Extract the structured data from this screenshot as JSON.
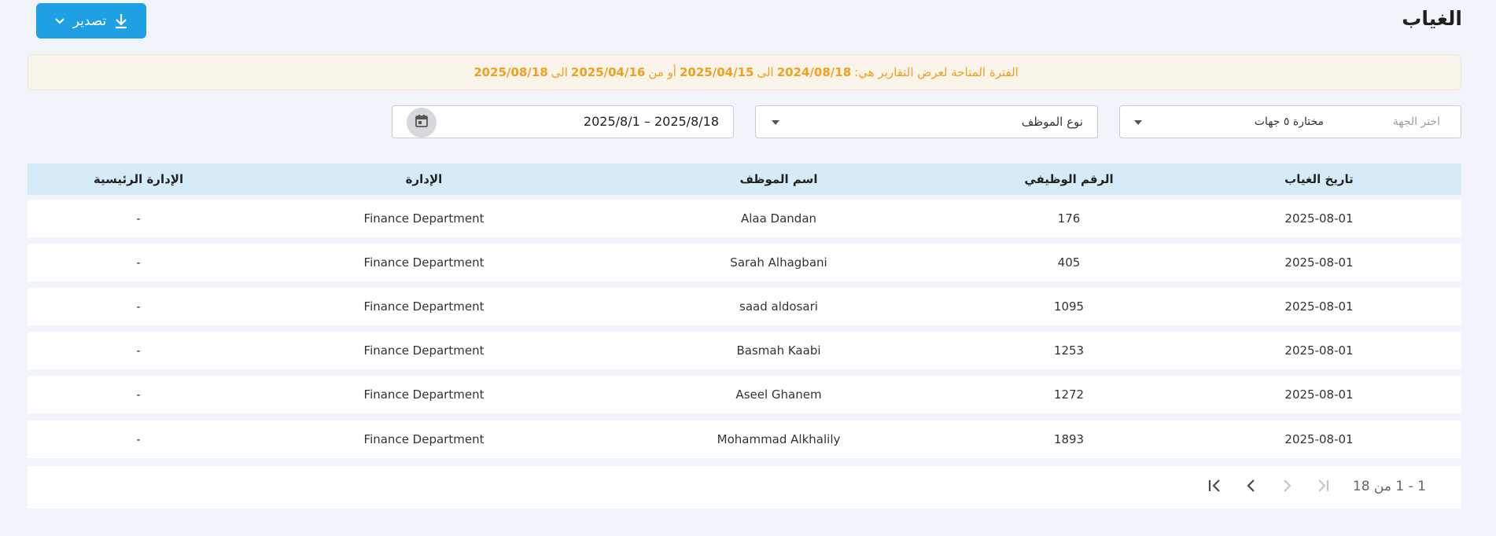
{
  "page": {
    "title": "الغياب"
  },
  "toolbar": {
    "export_label": "تصدير"
  },
  "notice": {
    "prefix": "الفترة المتاحة لعرض التقارير هي:",
    "date1": "2024/08/18",
    "sep1": "الى",
    "date2": "2025/04/15",
    "sep2": "أو من",
    "date3": "2025/04/16",
    "sep3": "الى",
    "date4": "2025/08/18"
  },
  "filters": {
    "department_placeholder": "اختر الجهة",
    "department_value": "مختارة ٥ جهات",
    "employee_type_value": "نوع الموظف",
    "date_range_value": "2025/8/1 – 2025/8/18"
  },
  "table": {
    "headers": [
      "تاريخ الغياب",
      "الرقم الوظيفي",
      "اسم الموظف",
      "الإدارة",
      "الإدارة الرئيسية"
    ],
    "rows": [
      [
        "2025-08-01",
        "176",
        "Alaa Dandan",
        "Finance Department",
        "-"
      ],
      [
        "2025-08-01",
        "405",
        "Sarah Alhagbani",
        "Finance Department",
        "-"
      ],
      [
        "2025-08-01",
        "1095",
        "saad aldosari",
        "Finance Department",
        "-"
      ],
      [
        "2025-08-01",
        "1253",
        "Basmah Kaabi",
        "Finance Department",
        "-"
      ],
      [
        "2025-08-01",
        "1272",
        "Aseel Ghanem",
        "Finance Department",
        "-"
      ],
      [
        "2025-08-01",
        "1893",
        "Mohammad Alkhalily",
        "Finance Department",
        "-"
      ]
    ]
  },
  "pagination": {
    "range_label": "1 - 1 من 18"
  },
  "icons": {
    "export": "download-icon",
    "dropdown": "chevron-down-icon",
    "calendar": "calendar-icon",
    "first": "first-page-icon",
    "prev": "chevron-left-icon",
    "next": "chevron-right-icon",
    "last": "last-page-icon"
  },
  "colors": {
    "accent": "#1f9fe4",
    "notice_text": "#f0a020",
    "table_header_bg": "#d6ebf8",
    "page_bg": "#f1f4fb"
  }
}
